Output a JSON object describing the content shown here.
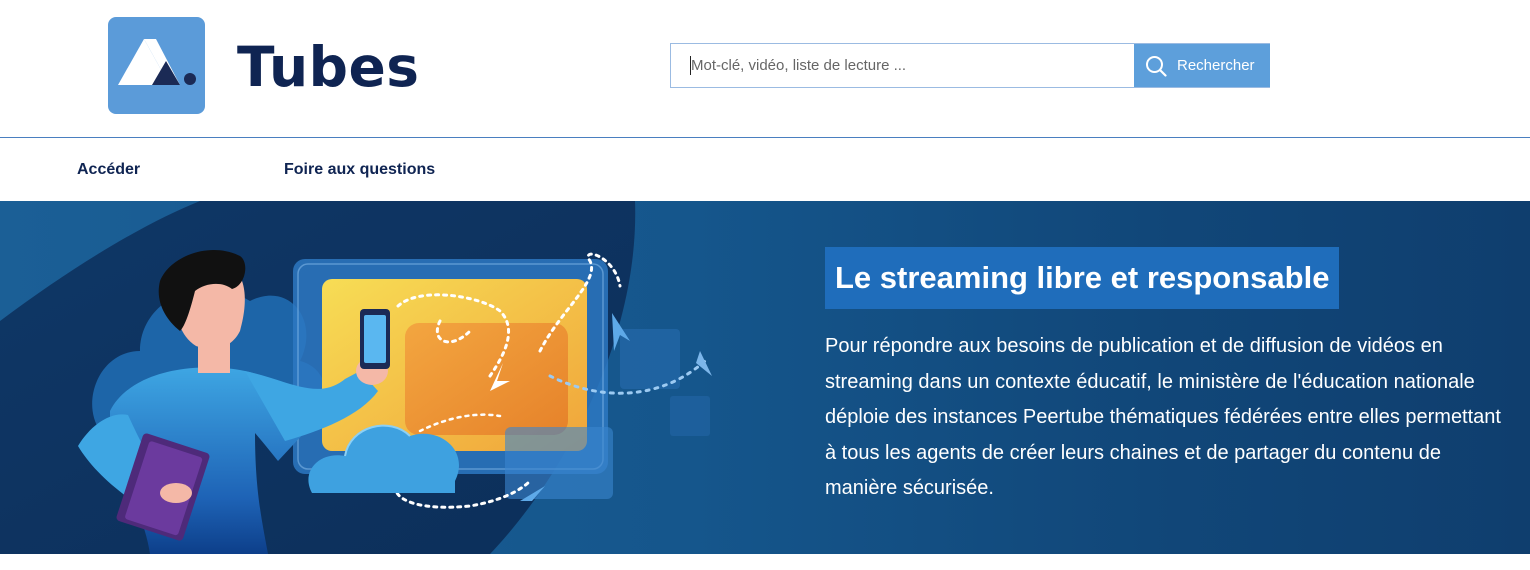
{
  "header": {
    "logo_icon": "tubes-logo-icon",
    "brand": "Tubes",
    "search": {
      "placeholder": "Mot-clé, vidéo, liste de lecture ...",
      "value": "",
      "button_label": "Rechercher",
      "button_icon": "search-icon"
    }
  },
  "nav": {
    "items": [
      {
        "label": "Accéder"
      },
      {
        "label": "Foire aux questions"
      }
    ]
  },
  "hero": {
    "title": "Le streaming libre et responsable",
    "text": "Pour répondre aux besoins de publication et de diffusion de vidéos en streaming dans un contexte éducatif, le ministère de l'éducation nationale déploie des instances Peertube thématiques fédérées entre elles permettant à tous les agents de créer leurs chaines et de partager du contenu de manière sécurisée.",
    "illustration": "person-with-phone-and-screen-illustration"
  },
  "colors": {
    "brand_dark": "#0f2452",
    "logo_bg": "#5b9bd9",
    "button_bg": "#5d9fdb",
    "hero_bg": "#15568c",
    "hero_title_bg": "#1f6dbb"
  }
}
